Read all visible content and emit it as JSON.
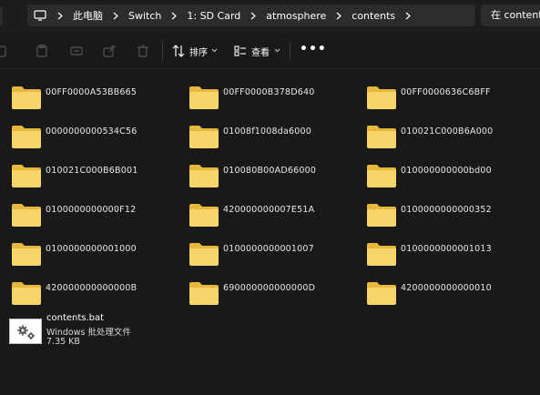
{
  "address_bar": {
    "breadcrumbs": [
      "此电脑",
      "Switch",
      "1: SD Card",
      "atmosphere",
      "contents"
    ],
    "search_text": "在 contents"
  },
  "command_bar": {
    "sort_label": "排序",
    "view_label": "查看",
    "more_label": "•••"
  },
  "folders": [
    "00FF0000A53BB665",
    "00FF0000B378D640",
    "00FF0000636C6BFF",
    "0000000000534C56",
    "01008f1008da6000",
    "010021C000B6A000",
    "010021C000B6B001",
    "010080B00AD66000",
    "010000000000bd00",
    "0100000000000F12",
    "420000000007E51A",
    "0100000000000352",
    "0100000000001000",
    "0100000000001007",
    "0100000000001013",
    "420000000000000B",
    "690000000000000D",
    "4200000000000010"
  ],
  "file": {
    "name": "contents.bat",
    "type": "Windows 批处理文件",
    "size": "7.35 KB"
  },
  "colors": {
    "background": "#191919",
    "folder_body": "#f8d56a",
    "folder_tab": "#e8b83c"
  }
}
